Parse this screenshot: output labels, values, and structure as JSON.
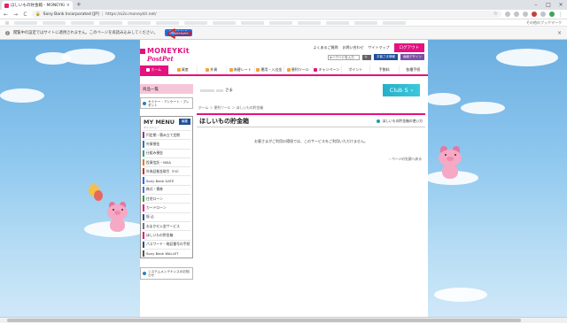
{
  "browser": {
    "tab_title": "ほしいもの貯金箱 - MONEYKit - ソ",
    "new_tab": "+",
    "back": "←",
    "forward": "→",
    "reload": "C",
    "site_name": "Sony Bank Incorporated [JP]",
    "separator": "|",
    "url": "https://o2o.moneykit.net/",
    "bookmarks_other": "その他のブックマーク"
  },
  "infobar": {
    "text": "閲覧中の設定ではサイトに適用されません。このページを再読み込みしてください。",
    "button": "再読み込み"
  },
  "header": {
    "brand": "MONEYKit",
    "sub_brand": "PostPet",
    "links": [
      "よくあるご質問",
      "お問い合わせ",
      "サイトマップ"
    ],
    "logout": "ログアウト",
    "search_placeholder": "キーワードを入力",
    "buttons": [
      "お客さま情報",
      "画面デザイン"
    ]
  },
  "gnav": [
    "ホーム",
    "資産",
    "外貨",
    "為替レート",
    "運用・入出金",
    "便利ツール",
    "キャンペーン",
    "ポイント",
    "手数料",
    "各種手続"
  ],
  "left": {
    "section": "商品一覧",
    "seminar": "セミナー・アンケート・プレゼント",
    "mymenu_title": "MY MENU",
    "mymenu_sub": "マイメニュー",
    "edit": "編集",
    "items": [
      {
        "label": "円定期・積み立て定期",
        "color": "#7b3fa0"
      },
      {
        "label": "外貨預金",
        "color": "#1b7bc2"
      },
      {
        "label": "仕組み預金",
        "color": "#2a9d8f"
      },
      {
        "label": "投資信託・NISA",
        "color": "#e07a1f"
      },
      {
        "label": "外為証拠金取引（FX）",
        "color": "#c0392b"
      },
      {
        "label": "Sony Bank GATE",
        "color": "#0d6efd"
      },
      {
        "label": "株式・債券",
        "color": "#4c6ef5"
      },
      {
        "label": "住宅ローン",
        "color": "#2f9e44"
      },
      {
        "label": "カードローン",
        "color": "#e4117f"
      },
      {
        "label": "振 込",
        "color": "#1e4f9b"
      },
      {
        "label": "おまかせ入金サービス",
        "color": "#6c757d"
      },
      {
        "label": "ほしいもの貯金箱",
        "color": "#e4117f"
      },
      {
        "label": "パスワード・暗証番号の手続",
        "color": "#1e4f9b"
      },
      {
        "label": "Sony Bank WALLET",
        "color": "#555555"
      }
    ],
    "system": "システムメンテナンスのお知らせ"
  },
  "main": {
    "suffix": "さま",
    "club": "Club S",
    "breadcrumb": "ホーム ＞ 便利ツール ＞ ほしいもの貯金箱",
    "title": "ほしいもの貯金箱",
    "how_to": "ほしいもの貯金箱の使い方",
    "notice": "お客さまがご利用の環境では、このサービスをご利用いただけません。",
    "to_top": "ページの先頭へ戻る"
  }
}
